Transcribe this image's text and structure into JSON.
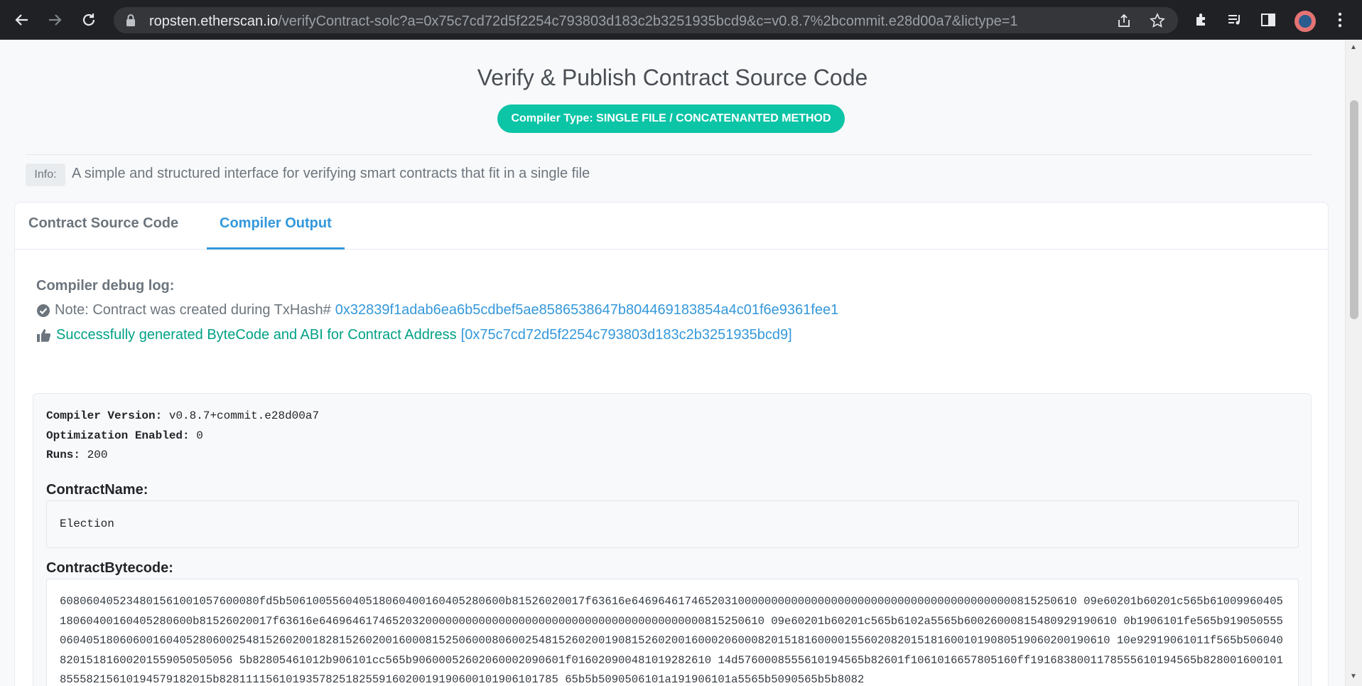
{
  "browser": {
    "url_host": "ropsten.etherscan.io",
    "url_path": "/verifyContract-solc?a=0x75c7cd72d5f2254c793803d183c2b3251935bcd9&c=v0.8.7%2bcommit.e28d00a7&lictype=1"
  },
  "header": {
    "title": "Verify & Publish Contract Source Code",
    "compiler_type": "Compiler Type: SINGLE FILE / CONCATENANTED METHOD"
  },
  "info": {
    "badge": "Info:",
    "text": "A simple and structured interface for verifying smart contracts that fit in a single file"
  },
  "tabs": [
    {
      "label": "Contract Source Code",
      "active": false
    },
    {
      "label": "Compiler Output",
      "active": true
    }
  ],
  "debug": {
    "title": "Compiler debug log:",
    "note_prefix": "Note: Contract was created during TxHash#",
    "tx_hash": "0x32839f1adab6ea6b5cdbef5ae8586538647b804469183854a4c01f6e9361fee1",
    "success_text": "Successfully generated ByteCode and ABI for Contract Address",
    "contract_address": "[0x75c7cd72d5f2254c793803d183c2b3251935bcd9]"
  },
  "output": {
    "compiler_version_label": "Compiler Version:",
    "compiler_version": "v0.8.7+commit.e28d00a7",
    "optimization_label": "Optimization Enabled:",
    "optimization": "0",
    "runs_label": "Runs:",
    "runs": "200",
    "contract_name_label": "ContractName:",
    "contract_name": "Election",
    "bytecode_label": "ContractBytecode:",
    "bytecode": "608060405234801561001057600080fd5b506100556040518060400160405280600b81526020017f63616e6469646174652031000000000000000000000000000000000000000000815250610 09e60201b60201c565b6100996040518060400160405280600b81526020017f63616e6469646174652032000000000000000000000000000000000000000000815250610 09e60201b60201c565b6102a5565b60026000815480929190610 0b1906101fe565b91905055506040518060600160405280600254815260200182815260200160008152506000806002548152602001908152602001600020600082015181600001556020820151816001019080519060200190610 10e92919061011f565b50604082015181600201559050505056 5b82805461012b906101cc565b90600052602060002090601f016020900481019282610 14d5760008555610194565b82601f1061016657805160ff1916838001178555610194565b82800160010185558215610194579182015b828111156101935782518255916020019190600101906101785 65b5b5090506101a191906101a5565b5090565b5b8082"
  }
}
